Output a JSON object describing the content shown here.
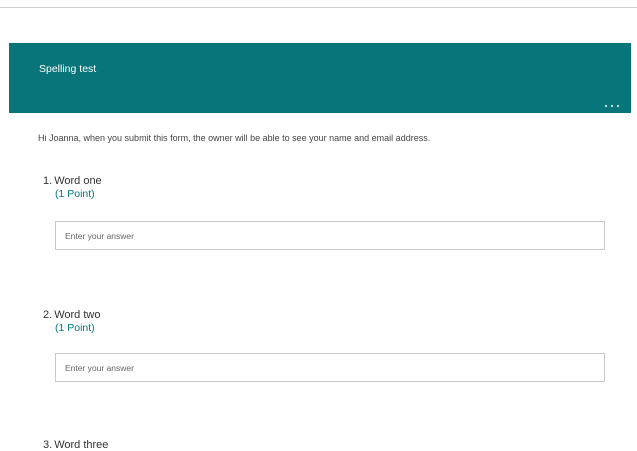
{
  "form": {
    "title": "Spelling test",
    "notice": "Hi Joanna, when you submit this form, the owner will be able to see your name and email address.",
    "more_icon": "ellipsis-icon"
  },
  "questions": [
    {
      "number": "1.",
      "title": "Word one",
      "points": "(1 Point)",
      "placeholder": "Enter your answer",
      "value": ""
    },
    {
      "number": "2.",
      "title": "Word two",
      "points": "(1 Point)",
      "placeholder": "Enter your answer",
      "value": ""
    },
    {
      "number": "3.",
      "title": "Word three"
    }
  ],
  "colors": {
    "header": "#077579",
    "points": "#077579"
  }
}
